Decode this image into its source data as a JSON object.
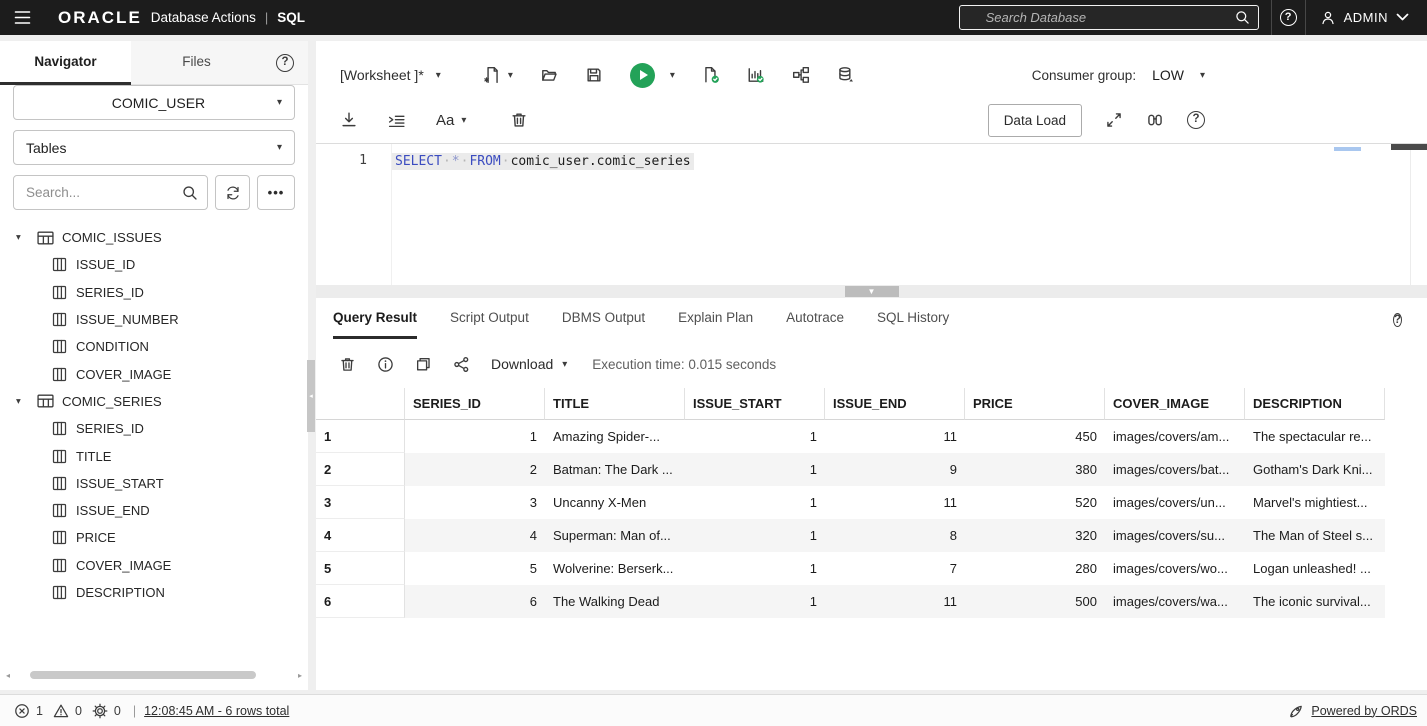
{
  "colors": {
    "topbar_bg": "#1c1c1c",
    "accent_green": "#23a258",
    "keyword_blue": "#3b4cc0",
    "active_tab_underline": "#2b2b2b",
    "row_stripe": "#f5f5f5"
  },
  "icons": {
    "caret_down": "▾",
    "more_options": "•••",
    "help": "?",
    "text_case": "Aa",
    "whitespace_dot": "·",
    "scroll_left": "◂",
    "scroll_right": "▸",
    "collapse_left": "◂",
    "divider_chevron": "▼"
  },
  "topbar": {
    "brand": "ORACLE",
    "app_title": "Database Actions",
    "divider": "|",
    "module": "SQL",
    "search_placeholder": "Search Database",
    "user_name": "ADMIN"
  },
  "sidebar": {
    "tabs": [
      {
        "label": "Navigator",
        "active": true
      },
      {
        "label": "Files",
        "active": false
      }
    ],
    "schema_selected": "COMIC_USER",
    "object_type_selected": "Tables",
    "search_placeholder": "Search...",
    "tree": [
      {
        "table": "COMIC_ISSUES",
        "columns": [
          "ISSUE_ID",
          "SERIES_ID",
          "ISSUE_NUMBER",
          "CONDITION",
          "COVER_IMAGE"
        ]
      },
      {
        "table": "COMIC_SERIES",
        "columns": [
          "SERIES_ID",
          "TITLE",
          "ISSUE_START",
          "ISSUE_END",
          "PRICE",
          "COVER_IMAGE",
          "DESCRIPTION"
        ]
      }
    ]
  },
  "worksheet": {
    "title": "[Worksheet ]*",
    "consumer_group_label": "Consumer group:",
    "consumer_group_value": "LOW",
    "data_load_button": "Data Load",
    "editor": {
      "line_number": "1",
      "sql_tokens": [
        {
          "text": "SELECT",
          "type": "keyword"
        },
        {
          "text": "*",
          "type": "star"
        },
        {
          "text": "FROM",
          "type": "keyword"
        },
        {
          "text": "comic_user.comic_series",
          "type": "identifier"
        }
      ]
    }
  },
  "results": {
    "tabs": [
      {
        "label": "Query Result",
        "active": true
      },
      {
        "label": "Script Output",
        "active": false
      },
      {
        "label": "DBMS Output",
        "active": false
      },
      {
        "label": "Explain Plan",
        "active": false
      },
      {
        "label": "Autotrace",
        "active": false
      },
      {
        "label": "SQL History",
        "active": false
      }
    ],
    "download_label": "Download",
    "execution_time": "Execution time: 0.015 seconds",
    "table": {
      "columns": [
        "SERIES_ID",
        "TITLE",
        "ISSUE_START",
        "ISSUE_END",
        "PRICE",
        "COVER_IMAGE",
        "DESCRIPTION"
      ],
      "rows": [
        {
          "num": "1",
          "cells": [
            "1",
            "Amazing Spider-...",
            "1",
            "11",
            "450",
            "images/covers/am...",
            "The spectacular re..."
          ]
        },
        {
          "num": "2",
          "cells": [
            "2",
            "Batman: The Dark ...",
            "1",
            "9",
            "380",
            "images/covers/bat...",
            "Gotham's Dark Kni..."
          ]
        },
        {
          "num": "3",
          "cells": [
            "3",
            "Uncanny X-Men",
            "1",
            "11",
            "520",
            "images/covers/un...",
            "Marvel's mightiest..."
          ]
        },
        {
          "num": "4",
          "cells": [
            "4",
            "Superman: Man of...",
            "1",
            "8",
            "320",
            "images/covers/su...",
            "The Man of Steel s..."
          ]
        },
        {
          "num": "5",
          "cells": [
            "5",
            "Wolverine: Berserk...",
            "1",
            "7",
            "280",
            "images/covers/wo...",
            "Logan unleashed! ..."
          ]
        },
        {
          "num": "6",
          "cells": [
            "6",
            "The Walking Dead",
            "1",
            "11",
            "500",
            "images/covers/wa...",
            "The iconic survival..."
          ]
        }
      ]
    }
  },
  "statusbar": {
    "errors": "1",
    "warnings": "0",
    "processes": "0",
    "divider": "|",
    "result_link": "12:08:45 AM - 6 rows total",
    "powered_by": "Powered by ORDS"
  }
}
